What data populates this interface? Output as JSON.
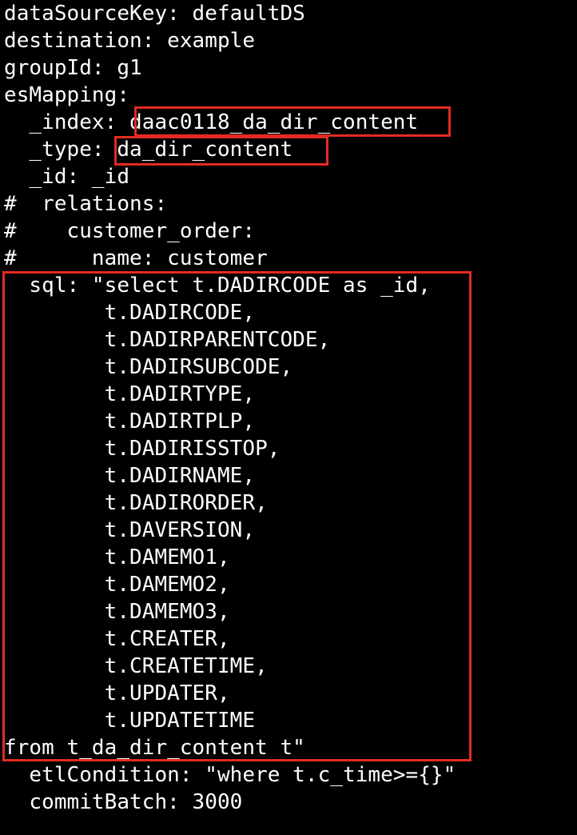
{
  "lines": [
    "dataSourceKey: defaultDS",
    "destination: example",
    "groupId: g1",
    "esMapping:",
    "  _index: daac0118_da_dir_content",
    "  _type: da_dir_content",
    "  _id: _id",
    "#  relations:",
    "#    customer_order:",
    "#      name: customer",
    "  sql: \"select t.DADIRCODE as _id,",
    "        t.DADIRCODE,",
    "        t.DADIRPARENTCODE,",
    "        t.DADIRSUBCODE,",
    "        t.DADIRTYPE,",
    "        t.DADIRTPLP,",
    "        t.DADIRISSTOP,",
    "        t.DADIRNAME,",
    "        t.DADIRORDER,",
    "        t.DAVERSION,",
    "        t.DAMEMO1,",
    "        t.DAMEMO2,",
    "        t.DAMEMO3,",
    "        t.CREATER,",
    "        t.CREATETIME,",
    "        t.UPDATER,",
    "        t.UPDATETIME",
    "from t_da_dir_content t\"",
    "  etlCondition: \"where t.c_time>={}\"",
    "  commitBatch: 3000"
  ],
  "highlight_color": "#e32b22"
}
